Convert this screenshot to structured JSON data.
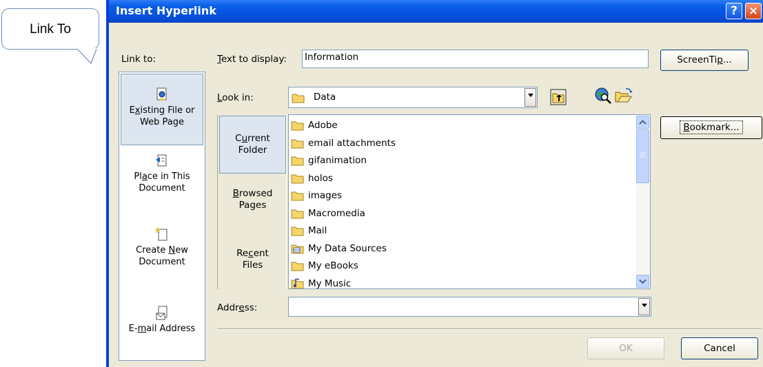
{
  "callout": {
    "text": "Link To"
  },
  "dialog": {
    "title": "Insert Hyperlink",
    "help_label": "?",
    "close_label": "×"
  },
  "link_to": {
    "label": "Link to:",
    "items": [
      {
        "line1_pre": "E",
        "line1_u": "x",
        "line1_post": "isting File or",
        "line2": "Web Page",
        "icon": "existing-file-icon",
        "active": true
      },
      {
        "line1_pre": "Pl",
        "line1_u": "a",
        "line1_post": "ce in This",
        "line2": "Document",
        "icon": "place-in-document-icon",
        "active": false
      },
      {
        "line1": "Create",
        "line2_pre": "",
        "line2_u": "N",
        "line2_post": "ew",
        "line3": "Document",
        "icon": "new-document-icon",
        "active": false
      },
      {
        "line1_pre": "E-",
        "line1_u": "m",
        "line1_post": "ail Address",
        "icon": "email-address-icon",
        "active": false
      }
    ]
  },
  "text_to_display": {
    "label_u": "T",
    "label_rest": "ext to display:",
    "value": "Information"
  },
  "screentip": {
    "pre": "ScreenTi",
    "u": "p",
    "post": "..."
  },
  "look_in": {
    "label_u": "L",
    "label_rest": "ook in:",
    "value": "Data",
    "icon": "folder-icon"
  },
  "toolbar_icons": [
    "up-one-folder-icon",
    "browse-web-icon",
    "browse-file-icon"
  ],
  "nav2": [
    {
      "line1_pre": "C",
      "line1_u": "u",
      "line1_post": "rrent",
      "line2": "Folder",
      "active": true
    },
    {
      "line1_pre": "",
      "line1_u": "B",
      "line1_post": "rowsed",
      "line2": "Pages",
      "active": false
    },
    {
      "line1_pre": "Re",
      "line1_u": "c",
      "line1_post": "ent",
      "line2": "Files",
      "active": false
    }
  ],
  "files": [
    {
      "name": "Adobe",
      "icon": "folder-icon"
    },
    {
      "name": "email attachments",
      "icon": "folder-icon"
    },
    {
      "name": "gifanimation",
      "icon": "folder-icon"
    },
    {
      "name": "holos",
      "icon": "folder-icon"
    },
    {
      "name": "images",
      "icon": "folder-icon"
    },
    {
      "name": "Macromedia",
      "icon": "folder-icon"
    },
    {
      "name": "Mail",
      "icon": "folder-icon"
    },
    {
      "name": "My Data Sources",
      "icon": "data-sources-folder-icon"
    },
    {
      "name": "My eBooks",
      "icon": "folder-icon"
    },
    {
      "name": "My Music",
      "icon": "music-folder-icon"
    }
  ],
  "bookmark": {
    "pre": "",
    "u": "B",
    "post": "ookmark..."
  },
  "address": {
    "label_pre": "Addr",
    "label_u": "e",
    "label_post": "ss:",
    "value": ""
  },
  "ok_label": "OK",
  "cancel_label": "Cancel"
}
